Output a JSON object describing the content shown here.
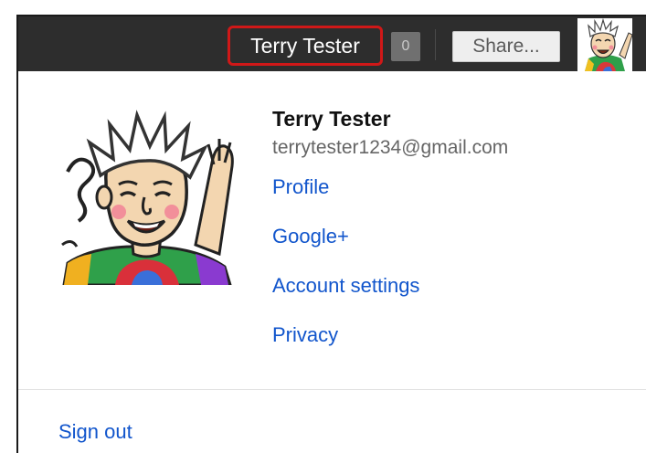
{
  "topbar": {
    "user_name": "Terry Tester",
    "notification_count": "0",
    "share_label": "Share..."
  },
  "account_card": {
    "name": "Terry Tester",
    "email": "terrytester1234@gmail.com",
    "links": [
      {
        "label": "Profile"
      },
      {
        "label": "Google+"
      },
      {
        "label": "Account settings"
      },
      {
        "label": "Privacy"
      }
    ],
    "sign_out_label": "Sign out"
  },
  "colors": {
    "topbar_bg": "#2d2d2d",
    "highlight_border": "#d01818",
    "link": "#1155cc",
    "notification_bg": "#707070"
  },
  "icons": {
    "small_avatar": "avatar-icon",
    "big_avatar": "avatar-icon"
  }
}
